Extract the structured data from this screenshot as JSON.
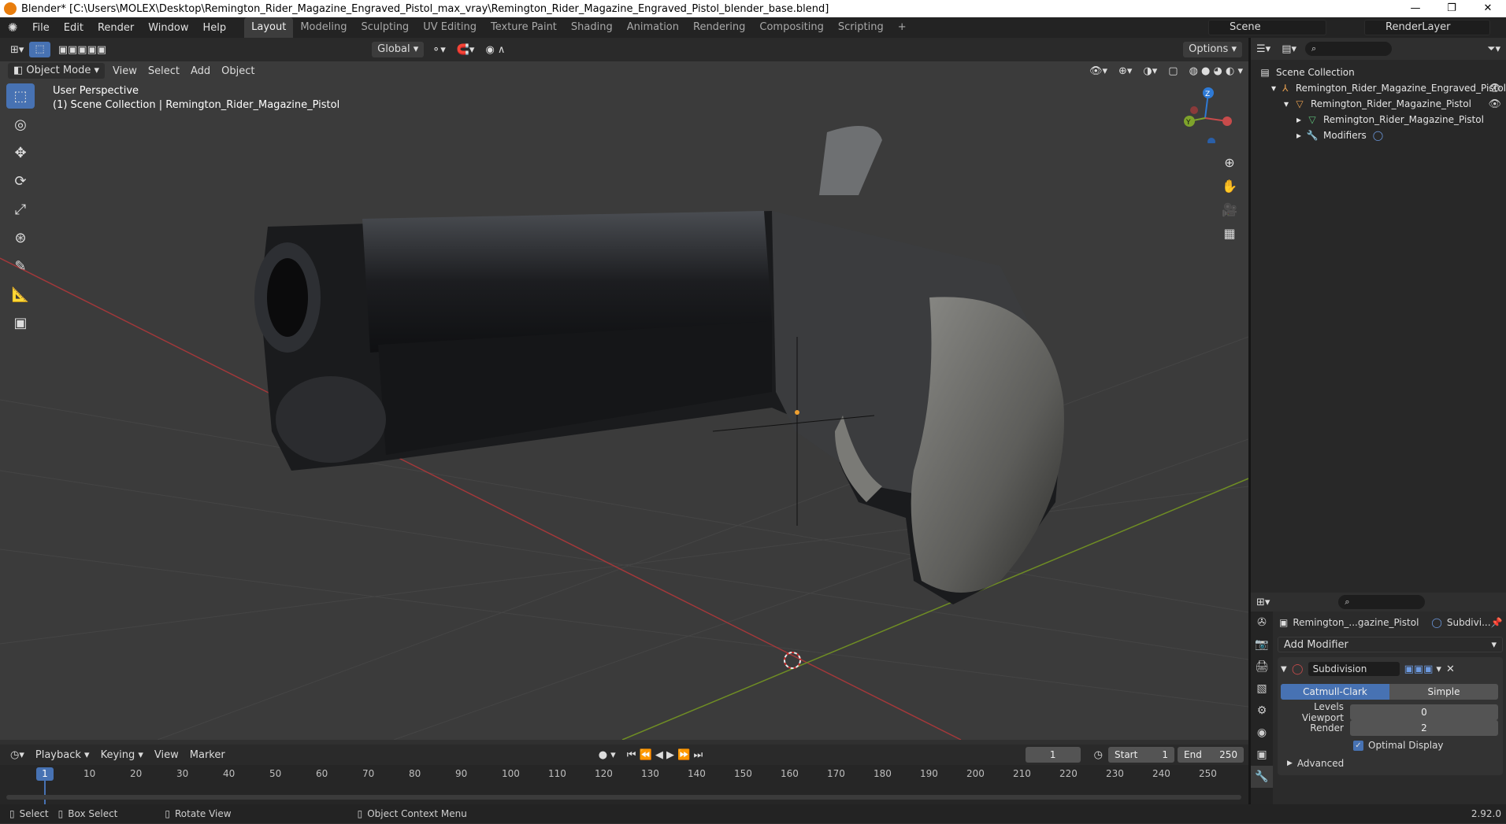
{
  "window": {
    "title": "Blender* [C:\\Users\\MOLEX\\Desktop\\Remington_Rider_Magazine_Engraved_Pistol_max_vray\\Remington_Rider_Magazine_Engraved_Pistol_blender_base.blend]",
    "minimize": "—",
    "maximize": "❐",
    "close": "✕"
  },
  "menu": [
    "File",
    "Edit",
    "Render",
    "Window",
    "Help"
  ],
  "workspaces": [
    "Layout",
    "Modeling",
    "Sculpting",
    "UV Editing",
    "Texture Paint",
    "Shading",
    "Animation",
    "Rendering",
    "Compositing",
    "Scripting",
    "+"
  ],
  "active_workspace": "Layout",
  "scene": {
    "name": "Scene",
    "render_layer": "RenderLayer"
  },
  "viewport_header": {
    "transform_orientation": "Global",
    "options": "Options",
    "mode": "Object Mode",
    "menus": [
      "View",
      "Select",
      "Add",
      "Object"
    ]
  },
  "viewport": {
    "perspective": "User Perspective",
    "collection_info": "(1) Scene Collection | Remington_Rider_Magazine_Pistol"
  },
  "gizmo": {
    "x": "X",
    "y": "Y",
    "z": "Z"
  },
  "outliner": {
    "root": "Scene Collection",
    "items": [
      {
        "label": "Remington_Rider_Magazine_Engraved_Pistol"
      },
      {
        "label": "Remington_Rider_Magazine_Pistol"
      },
      {
        "label": "Remington_Rider_Magazine_Pistol"
      },
      {
        "label": "Modifiers"
      }
    ]
  },
  "properties": {
    "object_name": "Remington_...gazine_Pistol",
    "modifier_tab": "Subdivi...",
    "add_modifier": "Add Modifier",
    "modifier_name": "Subdivision",
    "catmull": "Catmull-Clark",
    "simple": "Simple",
    "levels_viewport_label": "Levels Viewport",
    "levels_viewport": "0",
    "render_label": "Render",
    "render_value": "2",
    "optimal_display": "Optimal Display",
    "advanced": "Advanced"
  },
  "timeline": {
    "menus": [
      "Playback",
      "Keying",
      "View",
      "Marker"
    ],
    "current_frame": "1",
    "start_label": "Start",
    "start": "1",
    "end_label": "End",
    "end": "250",
    "ticks": [
      "10",
      "20",
      "30",
      "40",
      "50",
      "60",
      "70",
      "80",
      "90",
      "100",
      "110",
      "120",
      "130",
      "140",
      "150",
      "160",
      "170",
      "180",
      "190",
      "200",
      "210",
      "220",
      "230",
      "240",
      "250"
    ],
    "playhead": "1"
  },
  "status": {
    "select": "Select",
    "box_select": "Box Select",
    "rotate_view": "Rotate View",
    "context_menu": "Object Context Menu",
    "version": "2.92.0"
  },
  "colors": {
    "accent": "#4772b3",
    "x_axis": "#c74b4b",
    "y_axis": "#7ea32b",
    "z_axis": "#2e7ad6"
  }
}
